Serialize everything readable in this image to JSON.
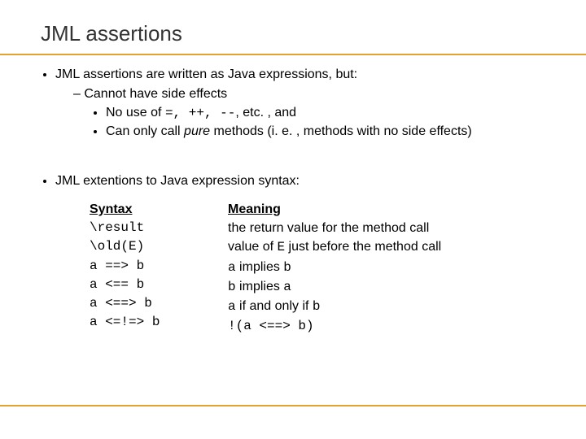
{
  "title": "JML assertions",
  "b1": {
    "lead": "JML assertions are written as Java expressions, but:",
    "sub1": "Cannot have side effects",
    "sub1a_pre": "No use of ",
    "sub1a_ops": "=, ++, --",
    "sub1a_post": ", etc. , and",
    "sub1b_pre": "Can only call ",
    "sub1b_em": "pure",
    "sub1b_post": " methods (i. e. , methods with no side effects)"
  },
  "b2": {
    "lead": "JML extentions to Java expression syntax:"
  },
  "table": {
    "hdr_syntax": "Syntax",
    "hdr_meaning": "Meaning",
    "rows": [
      {
        "s": "\\result",
        "m_pre": "the return value for the method call",
        "m_code": "",
        "m_mid": "",
        "m_code2": "",
        "m_post": ""
      },
      {
        "s": "\\old(E)",
        "m_pre": "value of ",
        "m_code": "E",
        "m_mid": " just before the method call",
        "m_code2": "",
        "m_post": ""
      },
      {
        "s": "a ==> b",
        "m_pre": "",
        "m_code": "a",
        "m_mid": " implies ",
        "m_code2": "b",
        "m_post": ""
      },
      {
        "s": "a <== b",
        "m_pre": "",
        "m_code": "b",
        "m_mid": " implies ",
        "m_code2": "a",
        "m_post": ""
      },
      {
        "s": "a <==> b",
        "m_pre": "",
        "m_code": "a",
        "m_mid": " if and only if ",
        "m_code2": "b",
        "m_post": ""
      },
      {
        "s": "a <=!=> b",
        "m_pre": "",
        "m_code": "!(a <==> b)",
        "m_mid": "",
        "m_code2": "",
        "m_post": ""
      }
    ]
  }
}
